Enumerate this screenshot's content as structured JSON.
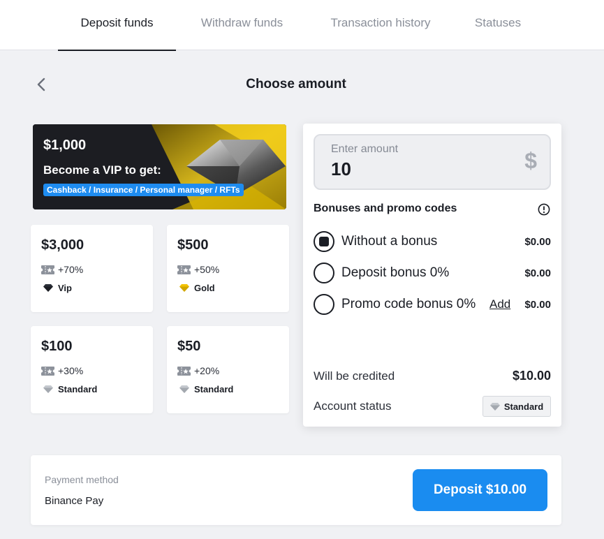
{
  "tabs": [
    {
      "label": "Deposit funds",
      "active": true
    },
    {
      "label": "Withdraw funds",
      "active": false
    },
    {
      "label": "Transaction history",
      "active": false
    },
    {
      "label": "Statuses",
      "active": false
    }
  ],
  "header": {
    "title": "Choose amount",
    "back_icon": "chevron-left-icon"
  },
  "vip_banner": {
    "amount": "$1,000",
    "headline": "Become a VIP to get:",
    "perks": "Cashback / Insurance / Personal manager / RFTs"
  },
  "amount_cards": [
    {
      "amount": "$3,000",
      "bonus": "+70%",
      "status": "Vip",
      "status_color": "#2b2f38"
    },
    {
      "amount": "$500",
      "bonus": "+50%",
      "status": "Gold",
      "status_color": "#f2c200"
    },
    {
      "amount": "$100",
      "bonus": "+30%",
      "status": "Standard",
      "status_color": "#b5b9c0"
    },
    {
      "amount": "$50",
      "bonus": "+20%",
      "status": "Standard",
      "status_color": "#b5b9c0"
    }
  ],
  "amount_input": {
    "label": "Enter amount",
    "value": "10",
    "currency_symbol": "$"
  },
  "bonuses": {
    "title": "Bonuses and promo codes",
    "options": [
      {
        "label": "Without a bonus",
        "value": "$0.00",
        "checked": true
      },
      {
        "label": "Deposit bonus 0%",
        "value": "$0.00",
        "checked": false
      },
      {
        "label": "Promo code bonus 0%",
        "value": "$0.00",
        "checked": false,
        "action": "Add"
      }
    ]
  },
  "summary": {
    "credited_label": "Will be credited",
    "credited_value": "$10.00",
    "status_label": "Account status",
    "status_value": "Standard"
  },
  "payment": {
    "label": "Payment method",
    "method": "Binance Pay",
    "button_label": "Deposit $10.00"
  },
  "colors": {
    "accent": "#1a8cf0",
    "gold": "#f2c200",
    "text": "#1a1d24",
    "muted": "#8a8f99"
  }
}
